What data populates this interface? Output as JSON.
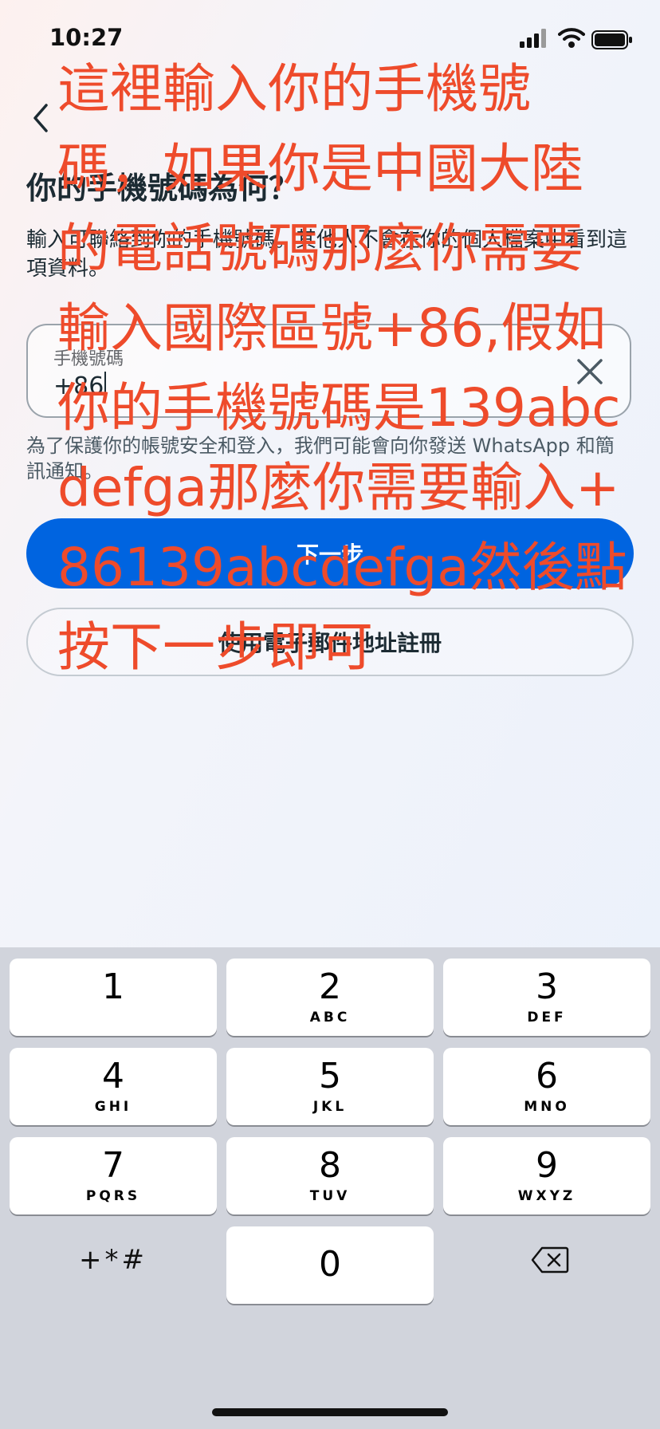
{
  "status_bar": {
    "time": "10:27"
  },
  "header": {
    "title": "你的手機號碼為何？",
    "description": "輸入可聯絡到你的手機號碼。其他人不會在你的個人檔案中看到這項資料。"
  },
  "phone_field": {
    "label": "手機號碼",
    "value": "+86"
  },
  "helper_text": "為了保護你的帳號安全和登入，我們可能會向你發送 WhatsApp 和簡訊通知。",
  "buttons": {
    "next": "下一步",
    "email_signup": "使用電子郵件地址註冊"
  },
  "annotation": "這裡輸入你的手機號碼，如果你是中國大陸的電話號碼那麼你需要輸入國際區號+86,假如你的手機號碼是139abcdefga那麼你需要輸入+86139abcdefga然後點按下一步即可",
  "keypad": {
    "keys": [
      {
        "digit": "1",
        "letters": ""
      },
      {
        "digit": "2",
        "letters": "ABC"
      },
      {
        "digit": "3",
        "letters": "DEF"
      },
      {
        "digit": "4",
        "letters": "GHI"
      },
      {
        "digit": "5",
        "letters": "JKL"
      },
      {
        "digit": "6",
        "letters": "MNO"
      },
      {
        "digit": "7",
        "letters": "PQRS"
      },
      {
        "digit": "8",
        "letters": "TUV"
      },
      {
        "digit": "9",
        "letters": "WXYZ"
      },
      {
        "digit": "0",
        "letters": ""
      }
    ],
    "symbols_label": "+*#"
  },
  "colors": {
    "primary": "#0064e0",
    "annotation": "#ee4b2b",
    "keyboard_bg": "#d1d4dc"
  },
  "icons": [
    "signal-icon",
    "wifi-icon",
    "battery-icon",
    "back-icon",
    "clear-icon",
    "delete-icon"
  ]
}
